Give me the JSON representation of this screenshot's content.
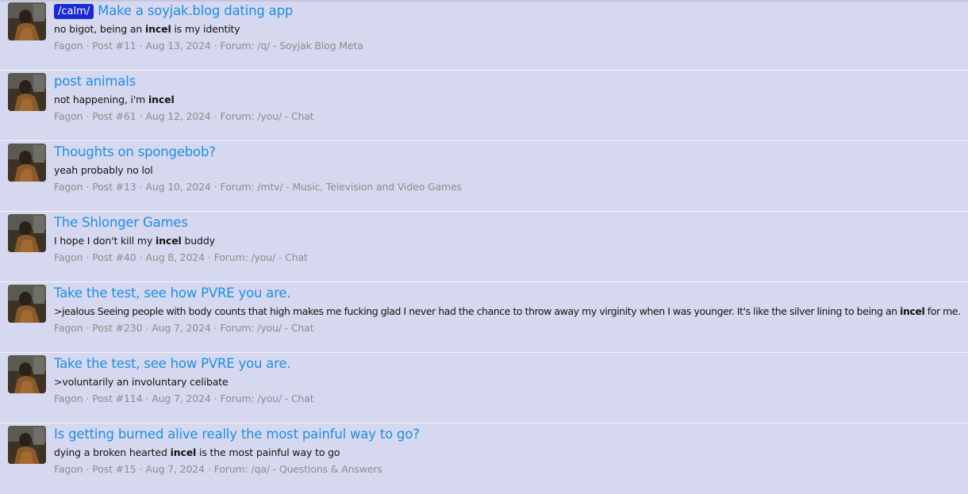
{
  "results": [
    {
      "prefix": "/calm/",
      "title": "Make a soyjak.blog dating app",
      "snippet_before": "no bigot, being an ",
      "snippet_highlight": "incel",
      "snippet_after": " is my identity",
      "author": "Fagon",
      "post": "Post #11",
      "date": "Aug 13, 2024",
      "forum_label": "Forum:",
      "forum": "/q/ - Soyjak Blog Meta"
    },
    {
      "prefix": "",
      "title": "post animals",
      "snippet_before": "not happening, i'm ",
      "snippet_highlight": "incel",
      "snippet_after": "",
      "author": "Fagon",
      "post": "Post #61",
      "date": "Aug 12, 2024",
      "forum_label": "Forum:",
      "forum": "/you/ - Chat"
    },
    {
      "prefix": "",
      "title": "Thoughts on spongebob?",
      "snippet_before": "yeah probably no lol",
      "snippet_highlight": "",
      "snippet_after": "",
      "author": "Fagon",
      "post": "Post #13",
      "date": "Aug 10, 2024",
      "forum_label": "Forum:",
      "forum": "/mtv/ - Music, Television and Video Games"
    },
    {
      "prefix": "",
      "title": "The Shlonger Games",
      "snippet_before": "I hope I don't kill my ",
      "snippet_highlight": "incel",
      "snippet_after": " buddy",
      "author": "Fagon",
      "post": "Post #40",
      "date": "Aug 8, 2024",
      "forum_label": "Forum:",
      "forum": "/you/ - Chat"
    },
    {
      "prefix": "",
      "title": "Take the test, see how PVRE you are.",
      "snippet_before": ">jealous Seeing people with body counts that high makes me fucking glad I never had the chance to throw away my virginity when I was younger. It's like the silver lining to being an ",
      "snippet_highlight": "incel",
      "snippet_after": " for me.",
      "author": "Fagon",
      "post": "Post #230",
      "date": "Aug 7, 2024",
      "forum_label": "Forum:",
      "forum": "/you/ - Chat"
    },
    {
      "prefix": "",
      "title": "Take the test, see how PVRE you are.",
      "snippet_before": ">voluntarily an involuntary celibate",
      "snippet_highlight": "",
      "snippet_after": "",
      "author": "Fagon",
      "post": "Post #114",
      "date": "Aug 7, 2024",
      "forum_label": "Forum:",
      "forum": "/you/ - Chat"
    },
    {
      "prefix": "",
      "title": "Is getting burned alive really the most painful way to go?",
      "snippet_before": "dying a broken hearted ",
      "snippet_highlight": "incel",
      "snippet_after": " is the most painful way to go",
      "author": "Fagon",
      "post": "Post #15",
      "date": "Aug 7, 2024",
      "forum_label": "Forum:",
      "forum": "/qa/ - Questions & Answers"
    }
  ],
  "meta_separator": "·",
  "colors": {
    "background": "#d6d8ef",
    "title_link": "#1c8ee3",
    "prefix_tag": "#1a29d6",
    "meta_text": "#8c8c8c"
  },
  "icons": {
    "avatar": "user-avatar-photo"
  }
}
